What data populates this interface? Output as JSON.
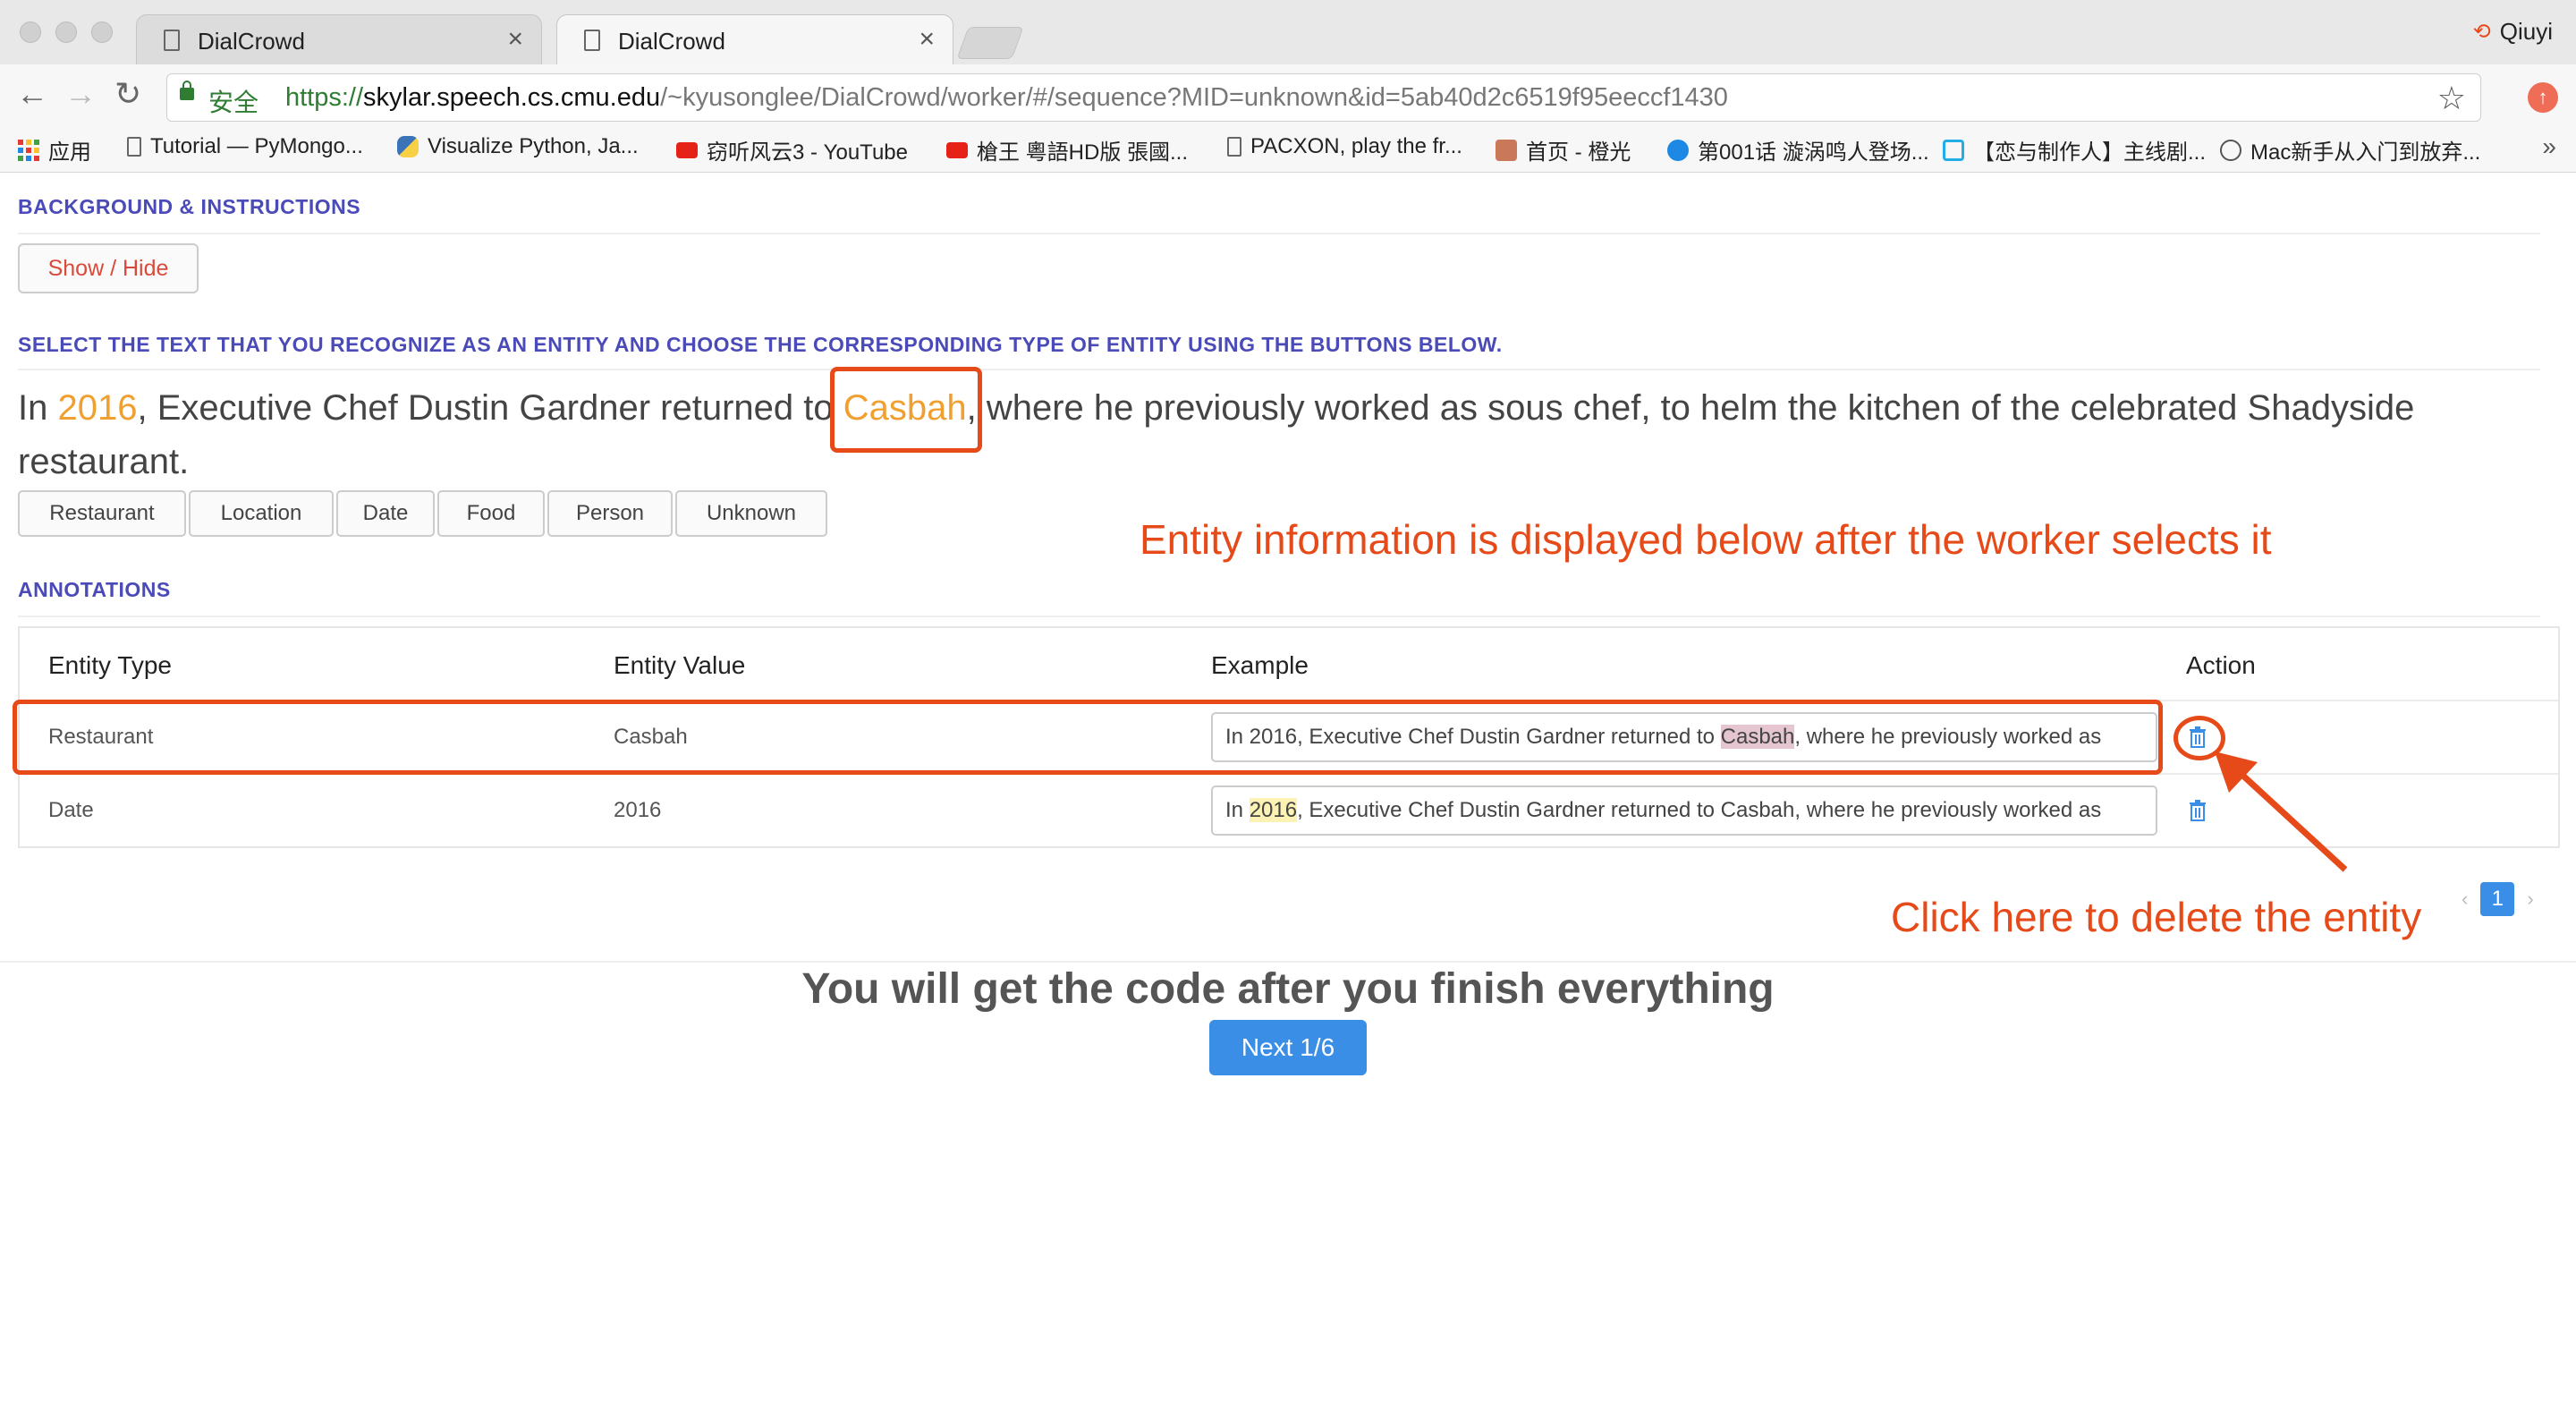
{
  "browser": {
    "tabs": [
      {
        "title": "DialCrowd",
        "close": "×"
      },
      {
        "title": "DialCrowd",
        "close": "×"
      }
    ],
    "profile_name": "Qiuyi",
    "secure_label": "安全",
    "url": {
      "scheme": "https://",
      "host": "skylar.speech.cs.cmu.edu",
      "path": "/~kyusonglee/DialCrowd/worker/#/sequence?MID=unknown&id=5ab40d2c6519f95eeccf1430"
    },
    "bookmarks": [
      {
        "label": "应用",
        "icon": "apps-grid-icon"
      },
      {
        "label": "Tutorial — PyMongo...",
        "icon": "document-icon"
      },
      {
        "label": "Visualize Python, Ja...",
        "icon": "python-icon"
      },
      {
        "label": "窃听风云3 - YouTube",
        "icon": "youtube-icon"
      },
      {
        "label": "槍王 粵語HD版 張國...",
        "icon": "youtube-icon"
      },
      {
        "label": "PACXON, play the fr...",
        "icon": "document-icon"
      },
      {
        "label": "首页 - 橙光",
        "icon": "avatar-icon"
      },
      {
        "label": "第001话 漩涡鸣人登场...",
        "icon": "play-icon"
      },
      {
        "label": "【恋与制作人】主线剧...",
        "icon": "bilibili-icon"
      },
      {
        "label": "Mac新手从入门到放弃...",
        "icon": "site-icon"
      }
    ],
    "more": "»"
  },
  "page": {
    "background_title": "BACKGROUND & INSTRUCTIONS",
    "show_hide_label": "Show / Hide",
    "select_title": "SELECT THE TEXT THAT YOU RECOGNIZE AS AN ENTITY AND CHOOSE THE CORRESPONDING TYPE OF ENTITY USING THE BUTTONS BELOW.",
    "sentence": {
      "part1": "In ",
      "ent1": "2016",
      "part2": ", Executive Chef Dustin Gardner returned to ",
      "ent2": "Casbah",
      "part3": ", where he previously worked as sous chef, to helm the kitchen of the celebrated Shadyside restaurant."
    },
    "entity_types": [
      "Restaurant",
      "Location",
      "Date",
      "Food",
      "Person",
      "Unknown"
    ],
    "annotations_title": "ANNOTATIONS",
    "table": {
      "headers": [
        "Entity Type",
        "Entity Value",
        "Example",
        "Action"
      ],
      "rows": [
        {
          "type": "Restaurant",
          "value": "Casbah",
          "example_before": "In 2016, Executive Chef Dustin Gardner returned to ",
          "example_highlight": "Casbah",
          "example_after": ", where he previously worked as"
        },
        {
          "type": "Date",
          "value": "2016",
          "example_before": "In ",
          "example_highlight": "2016",
          "example_after": ", Executive Chef Dustin Gardner returned to Casbah, where he previously worked as"
        }
      ]
    },
    "pagination": {
      "prev": "‹",
      "current": "1",
      "next": "›"
    },
    "finish_text": "You will get the code after you finish everything",
    "next_label": "Next 1/6"
  },
  "annotations": {
    "entity_info_note": "Entity information is displayed below after the worker selects it",
    "delete_note": "Click here to delete the entity",
    "accent_color": "#e64a19"
  },
  "colors": {
    "primary": "#3a8ee6",
    "section_title": "#4a4ab8",
    "entity_highlight": "#f0a030"
  }
}
